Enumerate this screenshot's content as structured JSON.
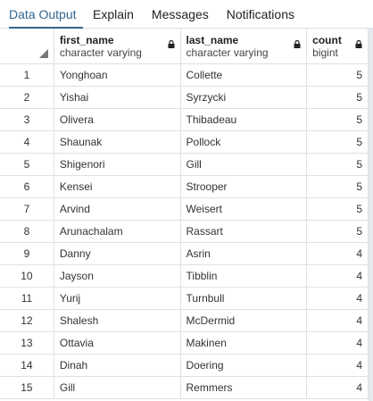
{
  "tabs": [
    "Data Output",
    "Explain",
    "Messages",
    "Notifications"
  ],
  "columns": [
    {
      "name": "first_name",
      "type": "character varying"
    },
    {
      "name": "last_name",
      "type": "character varying"
    },
    {
      "name": "count",
      "type": "bigint"
    }
  ],
  "rows": [
    [
      "1",
      "Yonghoan",
      "Collette",
      "5"
    ],
    [
      "2",
      "Yishai",
      "Syrzycki",
      "5"
    ],
    [
      "3",
      "Olivera",
      "Thibadeau",
      "5"
    ],
    [
      "4",
      "Shaunak",
      "Pollock",
      "5"
    ],
    [
      "5",
      "Shigenori",
      "Gill",
      "5"
    ],
    [
      "6",
      "Kensei",
      "Strooper",
      "5"
    ],
    [
      "7",
      "Arvind",
      "Weisert",
      "5"
    ],
    [
      "8",
      "Arunachalam",
      "Rassart",
      "5"
    ],
    [
      "9",
      "Danny",
      "Asrin",
      "4"
    ],
    [
      "10",
      "Jayson",
      "Tibblin",
      "4"
    ],
    [
      "11",
      "Yurij",
      "Turnbull",
      "4"
    ],
    [
      "12",
      "Shalesh",
      "McDermid",
      "4"
    ],
    [
      "13",
      "Ottavia",
      "Makinen",
      "4"
    ],
    [
      "14",
      "Dinah",
      "Doering",
      "4"
    ],
    [
      "15",
      "Gill",
      "Remmers",
      "4"
    ]
  ]
}
